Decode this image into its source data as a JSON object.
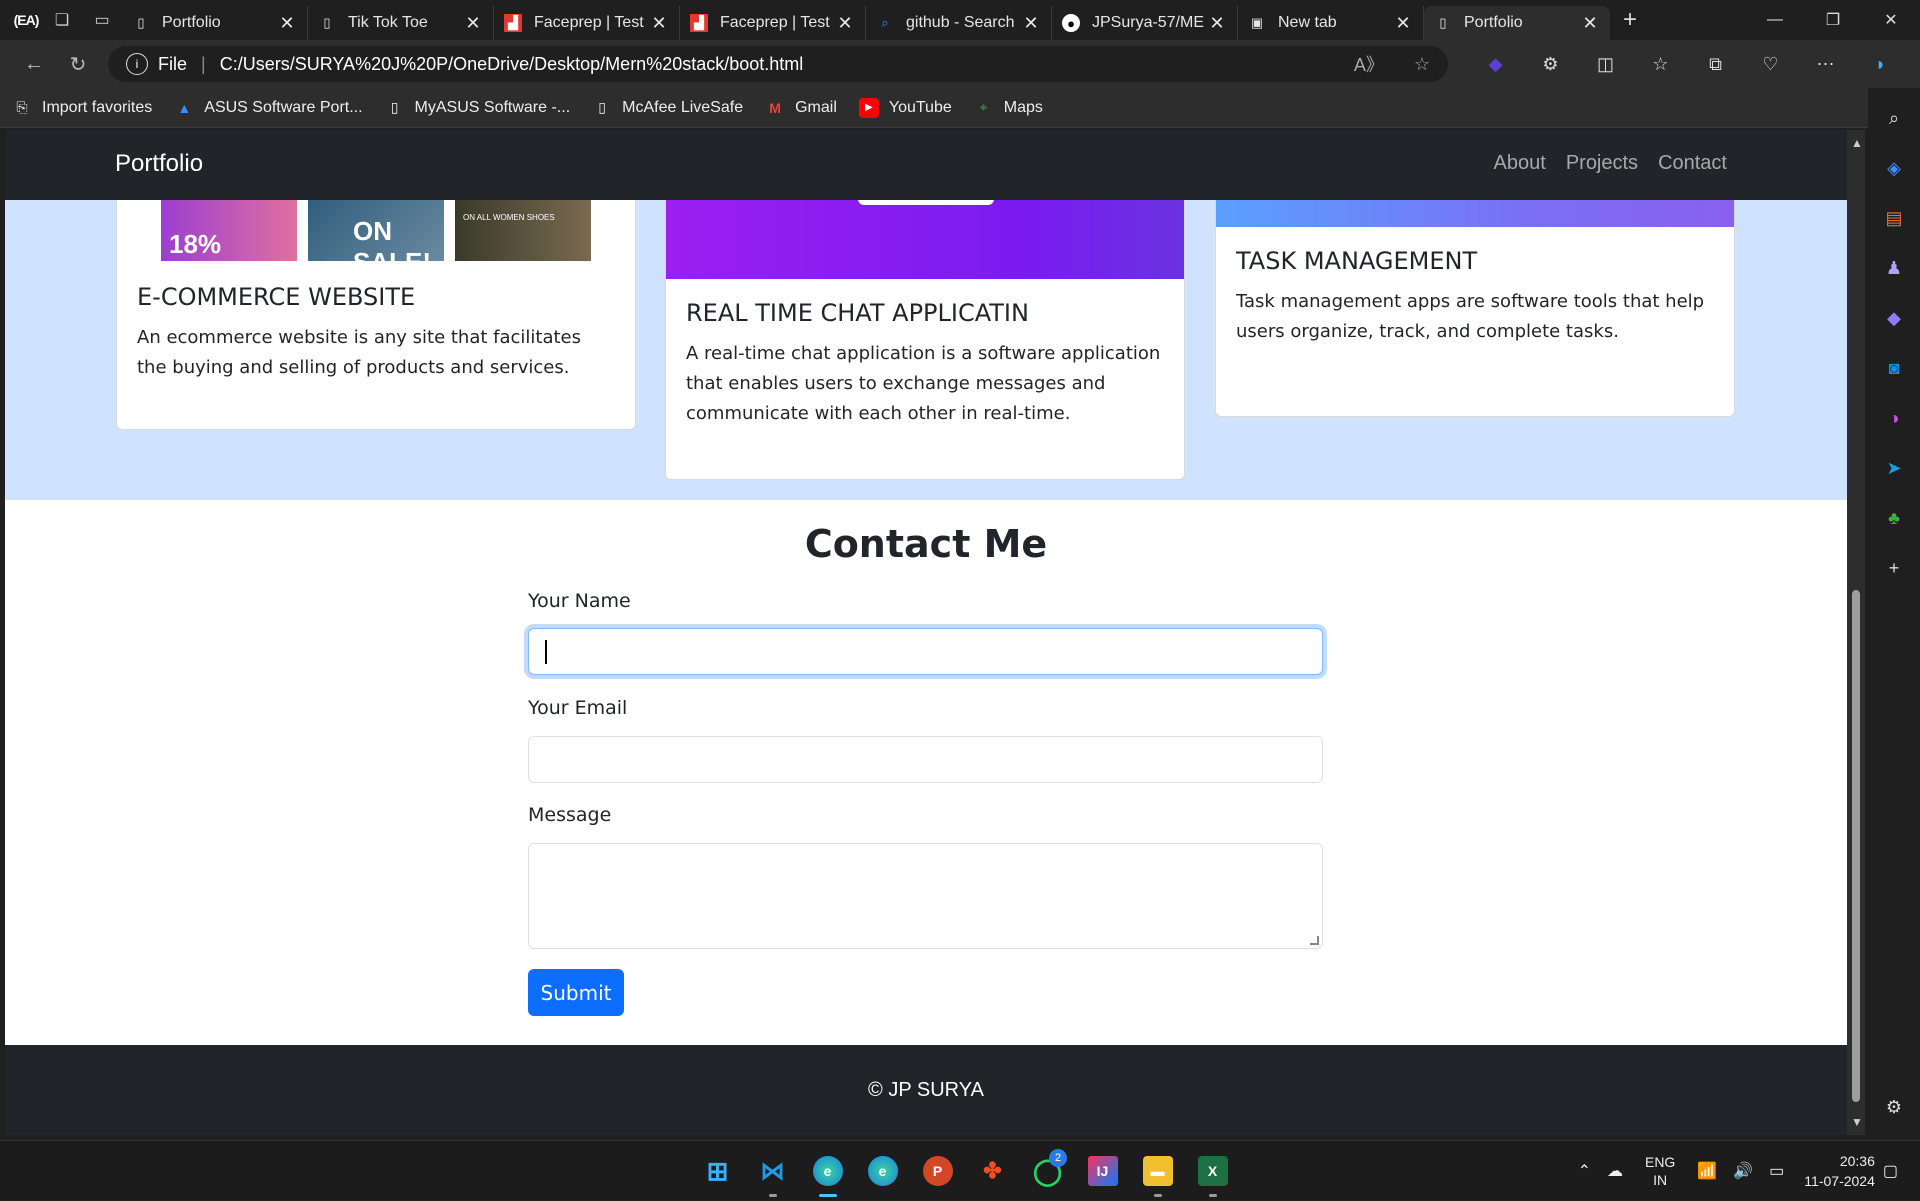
{
  "browser": {
    "tabs": [
      {
        "label": "Portfolio",
        "icon": "page-icon"
      },
      {
        "label": "Tik Tok Toe",
        "icon": "page-icon"
      },
      {
        "label": "Faceprep | Test",
        "icon": "faceprep-icon"
      },
      {
        "label": "Faceprep | Test",
        "icon": "faceprep-icon"
      },
      {
        "label": "github - Search",
        "icon": "search-icon"
      },
      {
        "label": "JPSurya-57/ME",
        "icon": "github-icon"
      },
      {
        "label": "New tab",
        "icon": "newtab-icon"
      },
      {
        "label": "Portfolio",
        "icon": "page-icon"
      }
    ],
    "address": {
      "scheme": "File",
      "url": "C:/Users/SURYA%20J%20P/OneDrive/Desktop/Mern%20stack/boot.html"
    },
    "bookmarks": [
      {
        "label": "Import favorites",
        "icon": "import-icon"
      },
      {
        "label": "ASUS Software Port...",
        "icon": "asus-icon"
      },
      {
        "label": "MyASUS Software -...",
        "icon": "page-icon"
      },
      {
        "label": "McAfee LiveSafe",
        "icon": "page-icon"
      },
      {
        "label": "Gmail",
        "icon": "gmail-icon"
      },
      {
        "label": "YouTube",
        "icon": "youtube-icon"
      },
      {
        "label": "Maps",
        "icon": "maps-icon"
      }
    ]
  },
  "site": {
    "brand": "Portfolio",
    "nav": [
      "About",
      "Projects",
      "Contact"
    ],
    "projects": [
      {
        "title": "E-COMMERCE WEBSITE",
        "text": "An ecommerce website is any site that facilitates the buying and selling of products and services.",
        "thumbs": [
          "18%",
          "ON SALE!",
          "ON ALL WOMEN SHOES"
        ]
      },
      {
        "title": "REAL TIME CHAT APPLICATIN",
        "text": "A real-time chat application is a software application that enables users to exchange messages and communicate with each other in real-time."
      },
      {
        "title": "TASK MANAGEMENT",
        "text": "Task management apps are software tools that help users organize, track, and complete tasks."
      }
    ],
    "contact": {
      "title": "Contact Me",
      "name_label": "Your Name",
      "email_label": "Your Email",
      "message_label": "Message",
      "submit": "Submit"
    },
    "footer": "© JP SURYA"
  },
  "taskbar": {
    "apps": [
      "windows-start",
      "vscode",
      "edge-profile",
      "edge",
      "powerpoint",
      "figma",
      "whatsapp",
      "intellij",
      "file-explorer",
      "excel"
    ],
    "whatsapp_badge": "2",
    "lang_top": "ENG",
    "lang_bottom": "IN",
    "time": "20:36",
    "date": "11-07-2024"
  }
}
